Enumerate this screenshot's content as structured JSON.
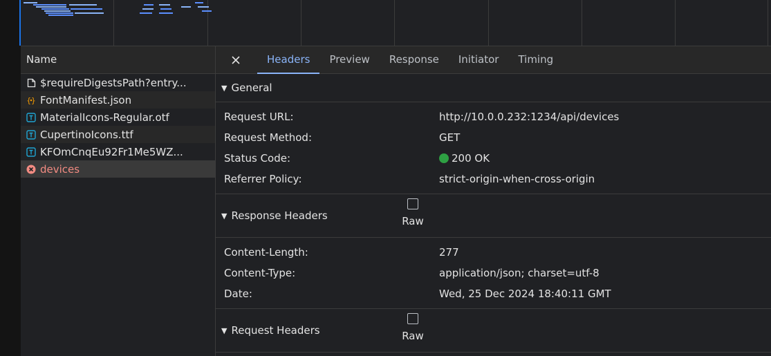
{
  "columns": {
    "name_header": "Name"
  },
  "requests": [
    {
      "name": "$requireDigestsPath?entry...",
      "icon": "document-icon"
    },
    {
      "name": "FontManifest.json",
      "icon": "json-icon"
    },
    {
      "name": "MaterialIcons-Regular.otf",
      "icon": "font-icon"
    },
    {
      "name": "CupertinoIcons.ttf",
      "icon": "font-icon"
    },
    {
      "name": "KFOmCnqEu92Fr1Me5WZ...",
      "icon": "font-icon"
    },
    {
      "name": "devices",
      "icon": "error-icon"
    }
  ],
  "tabs": {
    "close_glyph": "✕",
    "headers": "Headers",
    "preview": "Preview",
    "response": "Response",
    "initiator": "Initiator",
    "timing": "Timing"
  },
  "general": {
    "title": "General",
    "request_url_label": "Request URL:",
    "request_url": "http://10.0.0.232:1234/api/devices",
    "request_method_label": "Request Method:",
    "request_method": "GET",
    "status_code_label": "Status Code:",
    "status_code": "200 OK",
    "referrer_policy_label": "Referrer Policy:",
    "referrer_policy": "strict-origin-when-cross-origin"
  },
  "response_headers": {
    "title": "Response Headers",
    "raw_label": "Raw",
    "content_length_label": "Content-Length:",
    "content_length": "277",
    "content_type_label": "Content-Type:",
    "content_type": "application/json; charset=utf-8",
    "date_label": "Date:",
    "date": "Wed, 25 Dec 2024 18:40:11 GMT"
  },
  "request_headers": {
    "title": "Request Headers",
    "raw_label": "Raw"
  },
  "colors": {
    "accent": "#8ab4f8",
    "status_ok": "#2ea043",
    "error": "#f28b82"
  }
}
